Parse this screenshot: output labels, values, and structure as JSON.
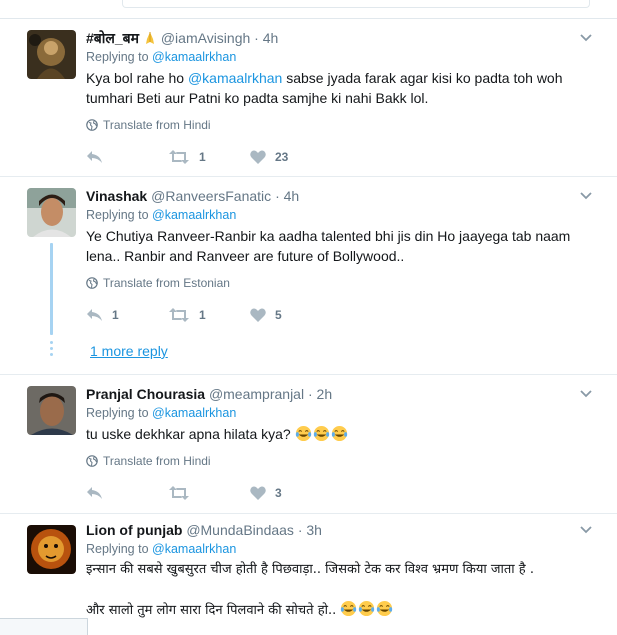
{
  "translate_icon": "globe-icon",
  "tweets": [
    {
      "fullname": "#बोल_बम",
      "screen_name": "@iamAvisingh",
      "separator": "·",
      "time": "4h",
      "replying_prefix": "Replying to",
      "replying_to": "@kamaalrkhan",
      "text_parts": [
        "Kya bol rahe ho ",
        "@kamaalrkhan",
        " sabse jyada farak agar kisi ko padta toh woh tumhari Beti aur Patni ko padta samjhe ki nahi Bakk lol."
      ],
      "translate": "Translate from Hindi",
      "reply_count": "",
      "retweet_count": "1",
      "like_count": "23"
    },
    {
      "fullname": "Vinashak",
      "screen_name": "@RanveersFanatic",
      "separator": "·",
      "time": "4h",
      "replying_prefix": "Replying to",
      "replying_to": "@kamaalrkhan",
      "text": "Ye Chutiya Ranveer-Ranbir ka aadha talented bhi jis din Ho jaayega tab naam lena.. Ranbir and Ranveer are future of Bollywood..",
      "translate": "Translate from Estonian",
      "reply_count": "1",
      "retweet_count": "1",
      "like_count": "5"
    },
    {
      "fullname": "Pranjal Chourasia",
      "screen_name": "@meampranjal",
      "separator": "·",
      "time": "2h",
      "replying_prefix": "Replying to",
      "replying_to": "@kamaalrkhan",
      "text": "tu uske dekhkar apna hilata kya?",
      "translate": "Translate from Hindi",
      "reply_count": "",
      "retweet_count": "",
      "like_count": "3"
    },
    {
      "fullname": "Lion of punjab",
      "screen_name": "@MundaBindaas",
      "separator": "·",
      "time": "3h",
      "replying_prefix": "Replying to",
      "replying_to": "@kamaalrkhan",
      "text_line1": "इन्सान की सबसे खुबसुरत चीज होती है पिछवाड़ा.. जिसको टेक कर विश्व भ्रमण किया जाता है .",
      "text_line2": "और सालो तुम लोग सारा दिन पिलवाने की सोचते हो.."
    }
  ],
  "more_reply": "1 more reply",
  "colors": {
    "link": "#1b95e0",
    "muted": "#657786",
    "thread": "#a6d3f2",
    "action_icon": "#aab8c2"
  }
}
